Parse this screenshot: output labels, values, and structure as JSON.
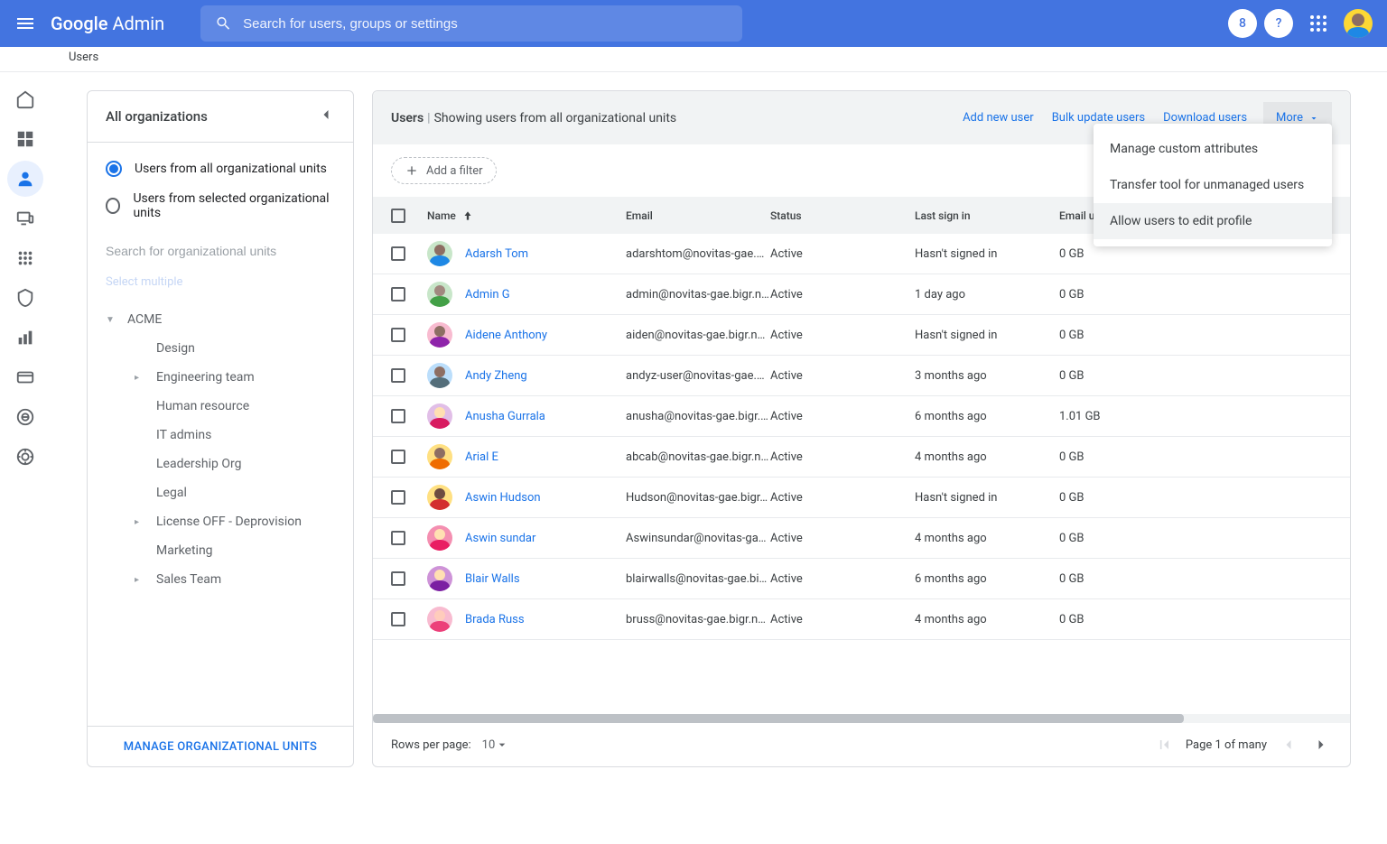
{
  "header": {
    "logo_google": "Google",
    "logo_admin": "Admin",
    "search_placeholder": "Search for users, groups or settings",
    "badge": "8"
  },
  "breadcrumb": "Users",
  "sidebar": {
    "title": "All organizations",
    "radio_all": "Users from all organizational units",
    "radio_selected": "Users from selected organizational units",
    "search_placeholder": "Search for organizational units",
    "select_multiple": "Select multiple",
    "root": "ACME",
    "children": [
      {
        "label": "Design",
        "caret": false
      },
      {
        "label": "Engineering team",
        "caret": true
      },
      {
        "label": "Human resource",
        "caret": false
      },
      {
        "label": "IT admins",
        "caret": false
      },
      {
        "label": "Leadership Org",
        "caret": false
      },
      {
        "label": "Legal",
        "caret": false
      },
      {
        "label": "License OFF - Deprovision",
        "caret": true
      },
      {
        "label": "Marketing",
        "caret": false
      },
      {
        "label": "Sales Team",
        "caret": true
      }
    ],
    "manage": "MANAGE ORGANIZATIONAL UNITS"
  },
  "main": {
    "title_bold": "Users",
    "title_rest": "Showing users from all organizational units",
    "actions": {
      "add": "Add new user",
      "bulk": "Bulk update users",
      "download": "Download users",
      "more": "More"
    },
    "dropdown": [
      "Manage custom attributes",
      "Transfer tool for unmanaged users",
      "Allow users to edit profile"
    ],
    "add_filter": "Add a filter",
    "columns": {
      "name": "Name",
      "email": "Email",
      "status": "Status",
      "signin": "Last sign in",
      "usage": "Email usage"
    },
    "rows": [
      {
        "name": "Adarsh Tom",
        "email": "adarshtom@novitas-gae.bi...",
        "status": "Active",
        "signin": "Hasn't signed in",
        "usage": "0 GB",
        "bg": "#c8e6c9",
        "head": "#8d6e63",
        "body": "#1e88e5"
      },
      {
        "name": "Admin G",
        "email": "admin@novitas-gae.bigr.na...",
        "status": "Active",
        "signin": "1 day ago",
        "usage": "0 GB",
        "bg": "#c8e6c9",
        "head": "#a1887f",
        "body": "#43a047"
      },
      {
        "name": "Aidene Anthony",
        "email": "aiden@novitas-gae.bigr.na...",
        "status": "Active",
        "signin": "Hasn't signed in",
        "usage": "0 GB",
        "bg": "#f8bbd0",
        "head": "#8d6e63",
        "body": "#8e24aa"
      },
      {
        "name": "Andy Zheng",
        "email": "andyz-user@novitas-gae.bi...",
        "status": "Active",
        "signin": "3 months ago",
        "usage": "0 GB",
        "bg": "#bbdefb",
        "head": "#8d6e63",
        "body": "#546e7a"
      },
      {
        "name": "Anusha Gurrala",
        "email": "anusha@novitas-gae.bigr.n...",
        "status": "Active",
        "signin": "6 months ago",
        "usage": "1.01 GB",
        "bg": "#e1bee7",
        "head": "#ffe0b2",
        "body": "#d81b60"
      },
      {
        "name": "Arial E",
        "email": "abcab@novitas-gae.bigr.na...",
        "status": "Active",
        "signin": "4 months ago",
        "usage": "0 GB",
        "bg": "#ffe082",
        "head": "#8d6e63",
        "body": "#ef6c00"
      },
      {
        "name": "Aswin Hudson",
        "email": "Hudson@novitas-gae.bigr.n...",
        "status": "Active",
        "signin": "Hasn't signed in",
        "usage": "0 GB",
        "bg": "#ffe082",
        "head": "#6d4c41",
        "body": "#d32f2f"
      },
      {
        "name": "Aswin sundar",
        "email": "Aswinsundar@novitas-gae....",
        "status": "Active",
        "signin": "4 months ago",
        "usage": "0 GB",
        "bg": "#f48fb1",
        "head": "#ffe0b2",
        "body": "#e91e63"
      },
      {
        "name": "Blair Walls",
        "email": "blairwalls@novitas-gae.bigr...",
        "status": "Active",
        "signin": "6 months ago",
        "usage": "0 GB",
        "bg": "#ce93d8",
        "head": "#ffe0b2",
        "body": "#7b1fa2"
      },
      {
        "name": "Brada Russ",
        "email": "bruss@novitas-gae.bigr.na...",
        "status": "Active",
        "signin": "4 months ago",
        "usage": "0 GB",
        "bg": "#f8bbd0",
        "head": "#ffccbc",
        "body": "#ec407a"
      }
    ],
    "footer": {
      "rows_label": "Rows per page:",
      "rows_value": "10",
      "page_text": "Page 1 of many"
    }
  }
}
